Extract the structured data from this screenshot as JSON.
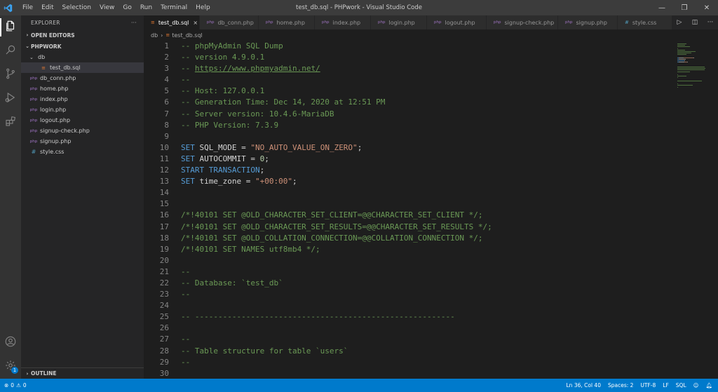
{
  "window": {
    "title": "test_db.sql - PHPwork - Visual Studio Code",
    "menu": [
      "File",
      "Edit",
      "Selection",
      "View",
      "Go",
      "Run",
      "Terminal",
      "Help"
    ]
  },
  "sidebar": {
    "title": "EXPLORER",
    "more": "···",
    "open_editors": "OPEN EDITORS",
    "workspace": "PHPWORK",
    "folder": "db",
    "folder_files": [
      {
        "name": "test_db.sql",
        "icon": "≡"
      }
    ],
    "files": [
      {
        "name": "db_conn.php",
        "icon": "php"
      },
      {
        "name": "home.php",
        "icon": "php"
      },
      {
        "name": "index.php",
        "icon": "php"
      },
      {
        "name": "login.php",
        "icon": "php"
      },
      {
        "name": "logout.php",
        "icon": "php"
      },
      {
        "name": "signup-check.php",
        "icon": "php"
      },
      {
        "name": "signup.php",
        "icon": "php"
      },
      {
        "name": "style.css",
        "icon": "#"
      }
    ],
    "outline": "OUTLINE"
  },
  "tabs": [
    {
      "label": "test_db.sql",
      "icon": "≡",
      "close": "×"
    },
    {
      "label": "db_conn.php",
      "icon": "php"
    },
    {
      "label": "home.php",
      "icon": "php"
    },
    {
      "label": "index.php",
      "icon": "php"
    },
    {
      "label": "login.php",
      "icon": "php"
    },
    {
      "label": "logout.php",
      "icon": "php"
    },
    {
      "label": "signup-check.php",
      "icon": "php"
    },
    {
      "label": "signup.php",
      "icon": "php"
    },
    {
      "label": "style.css",
      "icon": "#"
    }
  ],
  "breadcrumb": {
    "folder": "db",
    "file": "test_db.sql"
  },
  "code_lines": [
    [
      {
        "t": "c",
        "v": "-- phpMyAdmin SQL Dump"
      }
    ],
    [
      {
        "t": "c",
        "v": "-- version 4.9.0.1"
      }
    ],
    [
      {
        "t": "c",
        "v": "-- "
      },
      {
        "t": "l",
        "v": "https://www.phpmyadmin.net/"
      }
    ],
    [
      {
        "t": "c",
        "v": "--"
      }
    ],
    [
      {
        "t": "c",
        "v": "-- Host: 127.0.0.1"
      }
    ],
    [
      {
        "t": "c",
        "v": "-- Generation Time: Dec 14, 2020 at 12:51 PM"
      }
    ],
    [
      {
        "t": "c",
        "v": "-- Server version: 10.4.6-MariaDB"
      }
    ],
    [
      {
        "t": "c",
        "v": "-- PHP Version: 7.3.9"
      }
    ],
    [],
    [
      {
        "t": "k",
        "v": "SET "
      },
      {
        "t": "i",
        "v": "SQL_MODE = "
      },
      {
        "t": "s",
        "v": "\"NO_AUTO_VALUE_ON_ZERO\""
      },
      {
        "t": "i",
        "v": ";"
      }
    ],
    [
      {
        "t": "k",
        "v": "SET "
      },
      {
        "t": "i",
        "v": "AUTOCOMMIT = "
      },
      {
        "t": "n",
        "v": "0"
      },
      {
        "t": "i",
        "v": ";"
      }
    ],
    [
      {
        "t": "k",
        "v": "START TRANSACTION"
      },
      {
        "t": "i",
        "v": ";"
      }
    ],
    [
      {
        "t": "k",
        "v": "SET "
      },
      {
        "t": "i",
        "v": "time_zone = "
      },
      {
        "t": "s",
        "v": "\"+00:00\""
      },
      {
        "t": "i",
        "v": ";"
      }
    ],
    [],
    [],
    [
      {
        "t": "c",
        "v": "/*!40101 SET @OLD_CHARACTER_SET_CLIENT=@@CHARACTER_SET_CLIENT */;"
      }
    ],
    [
      {
        "t": "c",
        "v": "/*!40101 SET @OLD_CHARACTER_SET_RESULTS=@@CHARACTER_SET_RESULTS */;"
      }
    ],
    [
      {
        "t": "c",
        "v": "/*!40101 SET @OLD_COLLATION_CONNECTION=@@COLLATION_CONNECTION */;"
      }
    ],
    [
      {
        "t": "c",
        "v": "/*!40101 SET NAMES utf8mb4 */;"
      }
    ],
    [],
    [
      {
        "t": "c",
        "v": "--"
      }
    ],
    [
      {
        "t": "c",
        "v": "-- Database: `test_db`"
      }
    ],
    [
      {
        "t": "c",
        "v": "--"
      }
    ],
    [],
    [
      {
        "t": "c",
        "v": "-- --------------------------------------------------------"
      }
    ],
    [],
    [
      {
        "t": "c",
        "v": "--"
      }
    ],
    [
      {
        "t": "c",
        "v": "-- Table structure for table `users`"
      }
    ],
    [
      {
        "t": "c",
        "v": "--"
      }
    ],
    []
  ],
  "statusbar": {
    "errors": "0",
    "warnings": "0",
    "position": "Ln 36, Col 40",
    "spaces": "Spaces: 2",
    "encoding": "UTF-8",
    "eol": "LF",
    "language": "SQL"
  },
  "activity": {
    "settings_badge": "1"
  },
  "colors": {
    "accent": "#007acc",
    "comment": "#6a9955",
    "keyword": "#569cd6",
    "string": "#ce9178",
    "number": "#b5cea8"
  },
  "icons": [
    "vscode-logo-icon",
    "files-icon",
    "search-icon",
    "source-control-icon",
    "run-debug-icon",
    "extensions-icon",
    "account-icon",
    "settings-gear-icon",
    "run-icon",
    "split-editor-icon",
    "more-icon"
  ]
}
